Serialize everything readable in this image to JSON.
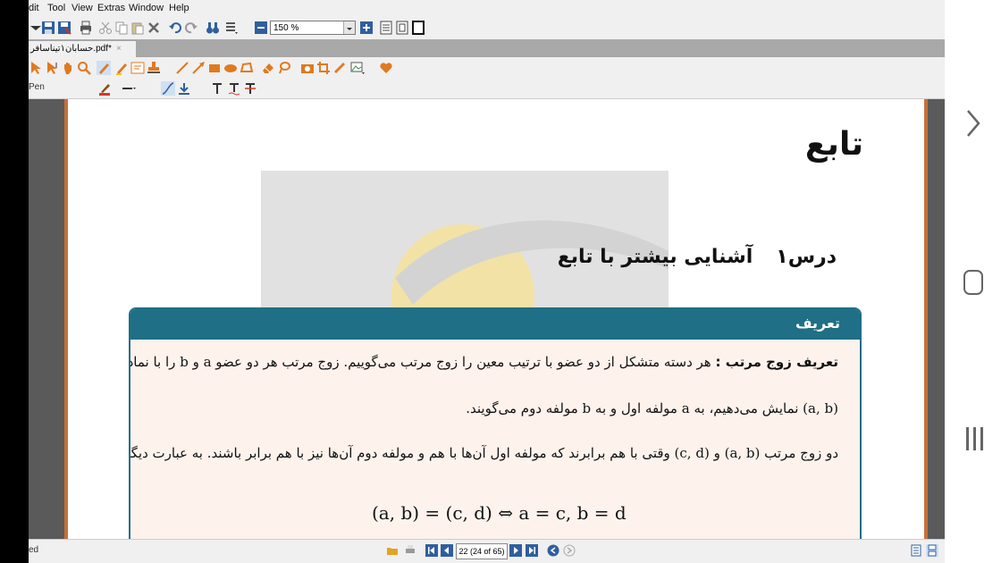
{
  "menu": [
    "dit",
    "Tool",
    "View",
    "Extras",
    "Window",
    "Help"
  ],
  "zoom": {
    "value": "150 %"
  },
  "tab": {
    "title": "حسابان۱تیناسافر.pdf*",
    "close": "×"
  },
  "toolbar3": {
    "pen_label": "Pen"
  },
  "document": {
    "chapter_title": "تابع",
    "lesson_number": "درس۱",
    "lesson_title": "آشنایی بیشتر با تابع",
    "definition_header": "تعریف",
    "line1_bold": "تعریف زوج مرتب :",
    "line1": "هر دسته متشکل از دو عضو با ترتیب معین را زوج مرتب می‌گوییم. زوج مرتب هر دو عضو a و b را با نماد",
    "line2": "(a, b) نمایش می‌دهیم، به a مولفه اول و به b مولفه دوم می‌گویند.",
    "line3": "دو زوج مرتب (a, b) و (c, d) وقتی با هم برابرند که مولفه اول آن‌ها با هم و مولفه دوم آن‌ها نیز با هم برابر باشند. به عبارت دیگر",
    "formula": "(a, b) = (c, d) ⇔ a = c, b = d"
  },
  "statusbar": {
    "left_text": "ed",
    "page_indicator": "22 (24 of 65)"
  },
  "colors": {
    "accent": "#1f6f86",
    "page_border": "#c7703a",
    "box_bg": "#fdf2ec"
  }
}
